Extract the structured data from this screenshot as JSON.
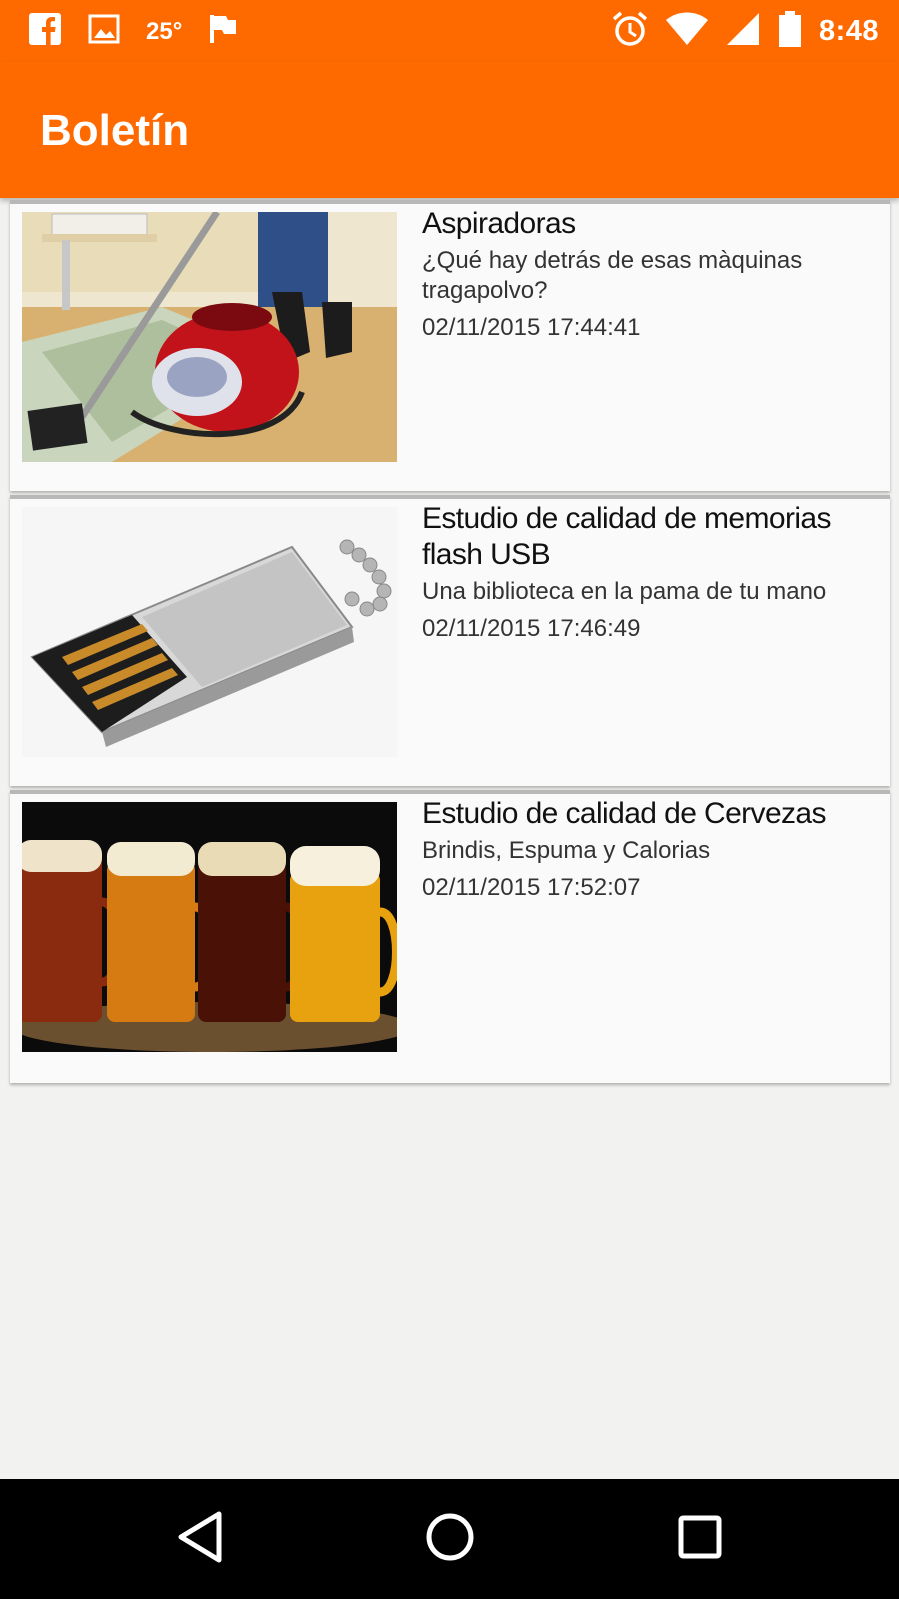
{
  "status_bar": {
    "temperature": "25°",
    "time": "8:48",
    "left_icons": [
      "facebook-icon",
      "image-icon",
      "flag-icon"
    ],
    "right_icons": [
      "alarm-icon",
      "wifi-icon",
      "signal-icon",
      "battery-icon"
    ]
  },
  "app_bar": {
    "title": "Boletín",
    "color": "#ff6a00"
  },
  "articles": [
    {
      "title": "Aspiradoras",
      "description": "¿Qué hay detrás de esas màquinas tragapolvo?",
      "date": "02/11/2015 17:44:41"
    },
    {
      "title": "Estudio de calidad de memorias flash USB",
      "description": "Una biblioteca en la pama de tu mano",
      "date": "02/11/2015 17:46:49"
    },
    {
      "title": "Estudio de calidad de Cervezas",
      "description": "Brindis, Espuma y Calorias",
      "date": "02/11/2015 17:52:07"
    }
  ],
  "nav_bar": {
    "buttons": [
      "back-icon",
      "home-icon",
      "recents-icon"
    ]
  }
}
